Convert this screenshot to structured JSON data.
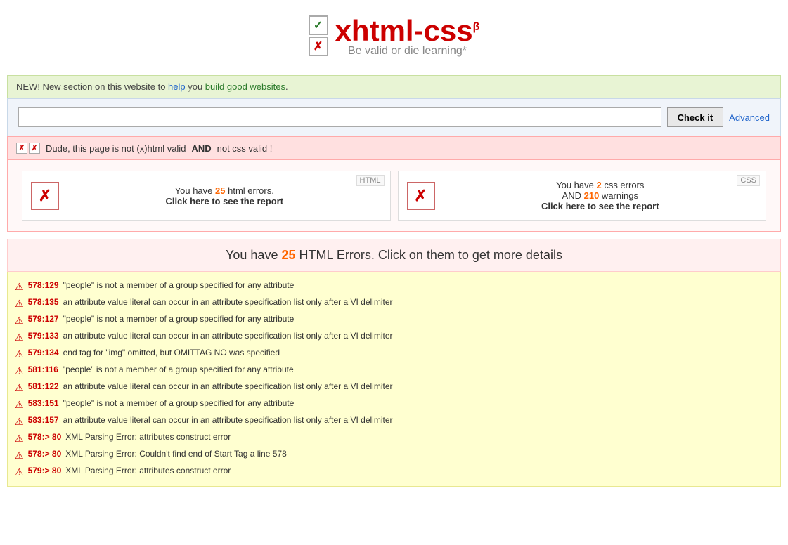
{
  "header": {
    "logo_text": "xhtml-css",
    "beta_label": "β",
    "tagline": "Be valid or die learning*"
  },
  "banner": {
    "text_pre": "NEW! New section on this website to ",
    "link_text": "help",
    "text_mid": " you ",
    "text_highlight": "build good websites",
    "text_end": "."
  },
  "check_bar": {
    "input_placeholder": "",
    "check_button_label": "Check it",
    "advanced_label": "Advanced"
  },
  "validity_banner": {
    "message_pre": "Dude, this page is not (x)html valid ",
    "and_text": "AND",
    "message_post": " not css valid !"
  },
  "html_report": {
    "label": "HTML",
    "error_count": "25",
    "text_pre": "You have ",
    "text_post": " html errors.",
    "click_text": "Click here to see the report"
  },
  "css_report": {
    "label": "CSS",
    "error_count": "2",
    "warning_count": "210",
    "text_pre": "You have ",
    "text_post": " css errors",
    "and_text": "AND ",
    "warning_text": " warnings",
    "click_text": "Click here to see the report"
  },
  "errors_header": {
    "text_pre": "You have ",
    "count": "25",
    "text_post": " HTML Errors. Click on them to get more details"
  },
  "errors": [
    {
      "location": "578:129",
      "message": "\"people\" is not a member of a group specified for any attribute"
    },
    {
      "location": "578:135",
      "message": "an attribute value literal can occur in an attribute specification list only after a VI delimiter"
    },
    {
      "location": "579:127",
      "message": "\"people\" is not a member of a group specified for any attribute"
    },
    {
      "location": "579:133",
      "message": "an attribute value literal can occur in an attribute specification list only after a VI delimiter"
    },
    {
      "location": "579:134",
      "message": "end tag for \"img\" omitted, but OMITTAG NO was specified"
    },
    {
      "location": "581:116",
      "message": "\"people\" is not a member of a group specified for any attribute"
    },
    {
      "location": "581:122",
      "message": "an attribute value literal can occur in an attribute specification list only after a VI delimiter"
    },
    {
      "location": "583:151",
      "message": "\"people\" is not a member of a group specified for any attribute"
    },
    {
      "location": "583:157",
      "message": "an attribute value literal can occur in an attribute specification list only after a VI delimiter"
    },
    {
      "location_xml": "578",
      "arrow": "> 80",
      "xml_message": "XML Parsing Error: attributes construct error"
    },
    {
      "location_xml": "578",
      "arrow": "> 80",
      "xml_message": "XML Parsing Error: Couldn't find end of Start Tag a line 578"
    },
    {
      "location_xml": "579",
      "arrow": "> 80",
      "xml_message": "XML Parsing Error: attributes construct error"
    }
  ]
}
